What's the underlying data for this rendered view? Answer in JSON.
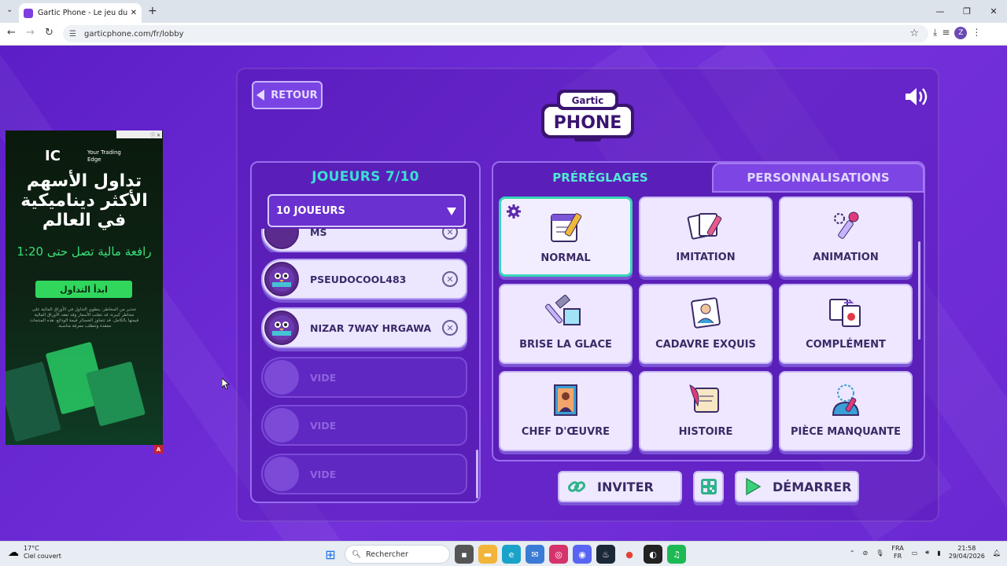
{
  "browser": {
    "tab_title": "Gartic Phone - Le jeu du téléph",
    "tab_close": "✕",
    "new_tab": "+",
    "url": "garticphone.com/fr/lobby"
  },
  "game": {
    "back_label": "RETOUR",
    "logo_top": "Gartic",
    "logo_main": "PHONE",
    "players_title": "JOUEURS 7/10",
    "player_count_select": "10 JOUEURS",
    "players": [
      {
        "name": "MS",
        "status": "filled"
      },
      {
        "name": "PSEUDOCOOL483",
        "status": "filled"
      },
      {
        "name": "NIZAR 7WAY HRGAWA",
        "status": "filled"
      },
      {
        "name": "VIDE",
        "status": "empty"
      },
      {
        "name": "VIDE",
        "status": "empty"
      },
      {
        "name": "VIDE",
        "status": "empty"
      }
    ],
    "tab_presets": "PRÉRÉGLAGES",
    "tab_custom": "PERSONNALISATIONS",
    "modes": [
      {
        "label": "NORMAL",
        "icon": "notepad-pencil-icon",
        "selected": true
      },
      {
        "label": "IMITATION",
        "icon": "cards-pencil-icon",
        "selected": false
      },
      {
        "label": "ANIMATION",
        "icon": "animation-icon",
        "selected": false
      },
      {
        "label": "BRISE LA GLACE",
        "icon": "hammer-ice-icon",
        "selected": false
      },
      {
        "label": "CADAVRE EXQUIS",
        "icon": "portrait-icon",
        "selected": false
      },
      {
        "label": "COMPLÉMENT",
        "icon": "complement-icon",
        "selected": false
      },
      {
        "label": "CHEF D'ŒUVRE",
        "icon": "masterpiece-icon",
        "selected": false
      },
      {
        "label": "HISTOIRE",
        "icon": "scroll-quill-icon",
        "selected": false
      },
      {
        "label": "PIÈCE MANQUANTE",
        "icon": "missing-piece-icon",
        "selected": false
      }
    ],
    "invite_label": "INVITER",
    "start_label": "DÉMARRER",
    "colors": {
      "accent_teal": "#3ae0d4",
      "panel": "#5a1fb8",
      "background": "#6a2ad0"
    }
  },
  "ad": {
    "brand": "IC",
    "tagline": "Your Trading Edge",
    "headline": "تداول الأسهم الأكثر ديناميكية في العالم",
    "subline": "رافعة مالية تصل حتى 1:20",
    "cta": "ابدأ التداول",
    "fine_print": "تحذير من المخاطر: ينطوي التداول في الأوراق المالية على مخاطر كبيرة، قد تتقلب الأسعار وقد تفقد الأوراق المالية قيمتها بالكامل. قد تتجاوز الخسائر قيمة الودائع. هذه المنتجات معقدة وتتطلب معرفة مناسبة.",
    "badge": "A"
  },
  "taskbar": {
    "weather_temp": "17°C",
    "weather_desc": "Ciel couvert",
    "search_label": "Rechercher",
    "lang_top": "FRA",
    "lang_bottom": "FR",
    "time": "21:58",
    "date": "29/04/2026"
  }
}
